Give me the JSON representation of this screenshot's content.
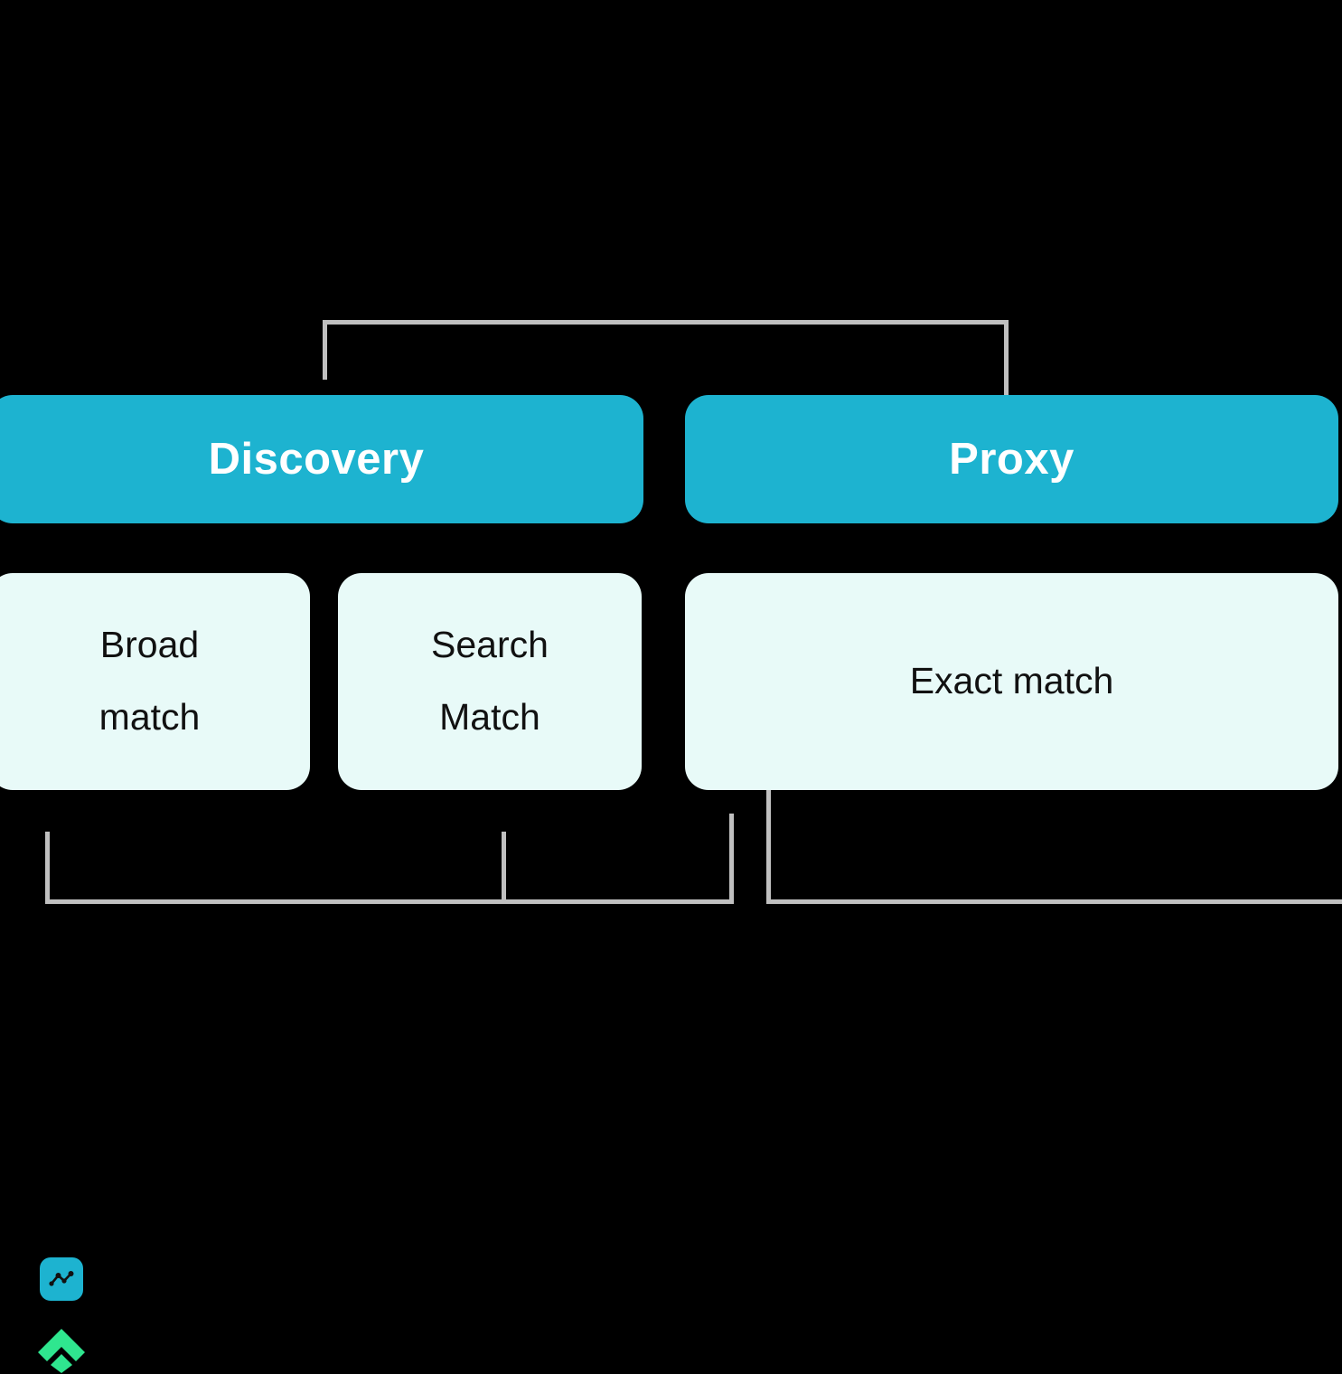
{
  "diagram": {
    "background_color": "#000000",
    "connector_color": "#c0c0c0",
    "header_color": "#1db3d0",
    "child_color": "#e8faf8",
    "headers": [
      {
        "id": "discovery",
        "label": "Discovery"
      },
      {
        "id": "proxy",
        "label": "Proxy"
      }
    ],
    "children": [
      {
        "id": "broad-match",
        "line1": "Broad",
        "line2": "match"
      },
      {
        "id": "search-match",
        "line1": "Search",
        "line2": "Match"
      },
      {
        "id": "exact-match",
        "line1": "Exact match",
        "line2": ""
      }
    ]
  },
  "branding": {
    "app_icon": {
      "name": "network-graph-icon",
      "background_color": "#1db3d0",
      "glyph_color": "#111111"
    },
    "chevron_logo": {
      "name": "chevron-diamond-logo",
      "color": "#2fe68f"
    }
  }
}
